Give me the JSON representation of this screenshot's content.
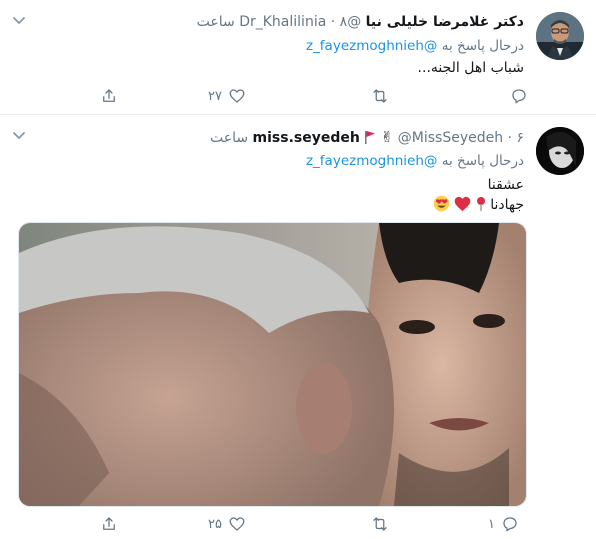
{
  "tweets": [
    {
      "name": "دکتر غلامرضا خلیلی نیا",
      "handle": "@Dr_Khalilinia",
      "dot": "·",
      "time": "۸ ساعت",
      "reply_prefix": "درحال پاسخ به",
      "reply_to": "@z_fayezmoghnieh",
      "text_lines": [
        "شباب اهل الجنه..."
      ],
      "actions": {
        "reply_count": "",
        "retweet_count": "",
        "like_count": "۲۷"
      }
    },
    {
      "name": "miss.seyedeh",
      "name_emoji": "✌",
      "handle": "@MissSeyedeh",
      "dot": "·",
      "time": "۶ ساعت",
      "reply_prefix": "درحال پاسخ به",
      "reply_to": "@z_fayezmoghnieh",
      "text_lines": [
        "عشقنا",
        "جهادنا"
      ],
      "actions": {
        "reply_count": "۱",
        "retweet_count": "",
        "like_count": "۲۵"
      }
    }
  ],
  "icons": {
    "reply": "comment-icon",
    "retweet": "retweet-icon",
    "like": "heart-icon",
    "share": "share-icon",
    "more": "chevron-down-icon"
  },
  "colors": {
    "accent": "#1b95e0",
    "muted": "#657786",
    "text": "#14171a",
    "divider": "#e6ecf0"
  }
}
